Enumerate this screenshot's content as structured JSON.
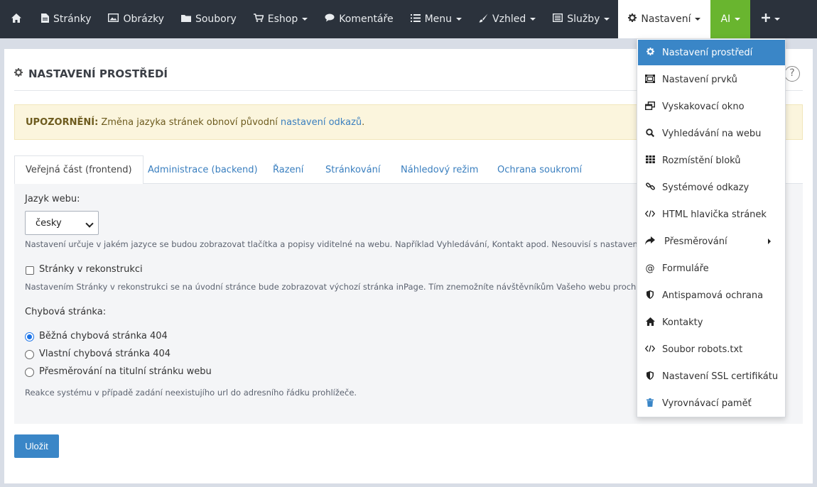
{
  "navbar": {
    "home_icon": "home-icon",
    "items": [
      {
        "label": "Stránky",
        "icon": "file-icon"
      },
      {
        "label": "Obrázky",
        "icon": "image-icon"
      },
      {
        "label": "Soubory",
        "icon": "folder-icon"
      },
      {
        "label": "Eshop",
        "icon": "cart-icon"
      },
      {
        "label": "Komentáře",
        "icon": "comments-icon"
      },
      {
        "label": "Menu",
        "icon": "list-icon"
      },
      {
        "label": "Vzhled",
        "icon": "brush-icon"
      },
      {
        "label": "Služby",
        "icon": "services-icon"
      },
      {
        "label": "Nastavení",
        "icon": "gear-icon"
      },
      {
        "label": "AI",
        "icon": ""
      }
    ],
    "colors": {
      "background": "#2b323c",
      "ai": "#69b52f"
    }
  },
  "page": {
    "title": "NASTAVENÍ PROSTŘEDÍ",
    "help_symbol": "?"
  },
  "alert": {
    "prefix": "UPOZORNĚNÍ:",
    "text": "Změna jazyka stránek obnoví původní",
    "link": "nastavení odkazů",
    "suffix": "."
  },
  "tabs": [
    {
      "label": "Veřejná část (frontend)",
      "active": true
    },
    {
      "label": "Administrace (backend)",
      "active": false
    },
    {
      "label": "Řazení",
      "active": false
    },
    {
      "label": "Stránkování",
      "active": false
    },
    {
      "label": "Náhledový režim",
      "active": false
    },
    {
      "label": "Ochrana soukromí",
      "active": false
    }
  ],
  "form": {
    "language_label": "Jazyk webu:",
    "language_value": "česky",
    "language_help": "Nastavení určuje v jakém jazyce se budou zobrazovat tlačítka a popisy viditelné na webu. Například Vyhledávání, Kontakt apod. Nesouvisí s nastavením jazyka a",
    "reconstruction_label": "Stránky v rekonstrukci",
    "reconstruction_checked": false,
    "reconstruction_help": "Nastavením Stránky v rekonstrukci se na úvodní stránce bude zobrazovat výchozí stránka inPage. Tím znemožníte návštěvníkům Vašeho webu procházet se ješ",
    "error_page_label": "Chybová stránka:",
    "error_options": [
      {
        "label": "Běžná chybová stránka 404",
        "checked": true
      },
      {
        "label": "Vlastní chybová stránka 404",
        "checked": false
      },
      {
        "label": "Přesměrování na titulní stránku webu",
        "checked": false
      }
    ],
    "error_help": "Reakce systému v případě zadání neexistujího url do adresního řádku prohlížeče.",
    "save_label": "Uložit"
  },
  "dropdown": {
    "items": [
      {
        "label": "Nastavení prostředí",
        "icon": "gear-icon",
        "active": true
      },
      {
        "label": "Nastavení prvků",
        "icon": "frame-icon",
        "active": false
      },
      {
        "label": "Vyskakovací okno",
        "icon": "popup-icon",
        "active": false
      },
      {
        "label": "Vyhledávání na webu",
        "icon": "search-icon",
        "active": false
      },
      {
        "label": "Rozmístění bloků",
        "icon": "grid-icon",
        "active": false
      },
      {
        "label": "Systémové odkazy",
        "icon": "link-icon",
        "active": false
      },
      {
        "label": "HTML hlavička stránek",
        "icon": "code-icon",
        "active": false
      },
      {
        "label": "Přesměrování",
        "icon": "redirect-icon",
        "active": false,
        "submenu": true
      },
      {
        "label": "Formuláře",
        "icon": "at-icon",
        "active": false
      },
      {
        "label": "Antispamová ochrana",
        "icon": "shield-icon",
        "active": false
      },
      {
        "label": "Kontakty",
        "icon": "home-icon",
        "active": false
      },
      {
        "label": "Soubor robots.txt",
        "icon": "code-icon",
        "active": false
      },
      {
        "label": "Nastavení SSL certifikátu",
        "icon": "shield-icon",
        "active": false
      },
      {
        "label": "Vyrovnávací paměť",
        "icon": "trash-icon",
        "active": false
      }
    ],
    "active_color": "#3a86c7"
  }
}
